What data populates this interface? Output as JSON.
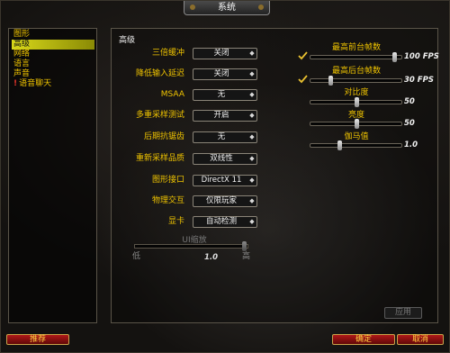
{
  "window": {
    "title": "系统"
  },
  "categories": [
    {
      "label": "图形",
      "selected": false,
      "warning": false
    },
    {
      "label": "高级",
      "selected": true,
      "warning": false
    },
    {
      "label": "网络",
      "selected": false,
      "warning": false
    },
    {
      "label": "语言",
      "selected": false,
      "warning": false
    },
    {
      "label": "声音",
      "selected": false,
      "warning": false
    },
    {
      "label": "语音聊天",
      "selected": false,
      "warning": true,
      "warning_icon": "!"
    }
  ],
  "panel": {
    "title": "高级"
  },
  "settings": [
    {
      "label": "三倍缓冲",
      "value": "关闭"
    },
    {
      "label": "降低输入延迟",
      "value": "关闭"
    },
    {
      "label": "MSAA",
      "value": "无"
    },
    {
      "label": "多重采样测试",
      "value": "开启"
    },
    {
      "label": "后期抗锯齿",
      "value": "无"
    },
    {
      "label": "重新采样品质",
      "value": "双线性"
    },
    {
      "label": "图形接口",
      "value": "DirectX 11"
    },
    {
      "label": "物理交互",
      "value": "仅限玩家"
    },
    {
      "label": "显卡",
      "value": "自动检测"
    }
  ],
  "sliders": [
    {
      "label": "最高前台帧数",
      "value": "100 FPS",
      "checked": true,
      "fraction": 0.92
    },
    {
      "label": "最高后台帧数",
      "value": "30 FPS",
      "checked": true,
      "fraction": 0.22
    },
    {
      "label": "对比度",
      "value": "50",
      "fraction": 0.5
    },
    {
      "label": "亮度",
      "value": "50",
      "fraction": 0.5
    },
    {
      "label": "伽马值",
      "value": "1.0",
      "fraction": 0.32
    }
  ],
  "ui_scale": {
    "label": "UI缩放",
    "min_label": "低",
    "max_label": "高",
    "value": "1.0",
    "fraction": 0.97
  },
  "buttons": {
    "recommend": "推荐",
    "ok": "确定",
    "cancel": "取消",
    "apply": "应用"
  },
  "colors": {
    "label_gold": "#f0c400",
    "button_red": "#a01010",
    "selected_yellow": "#d8d81a"
  }
}
